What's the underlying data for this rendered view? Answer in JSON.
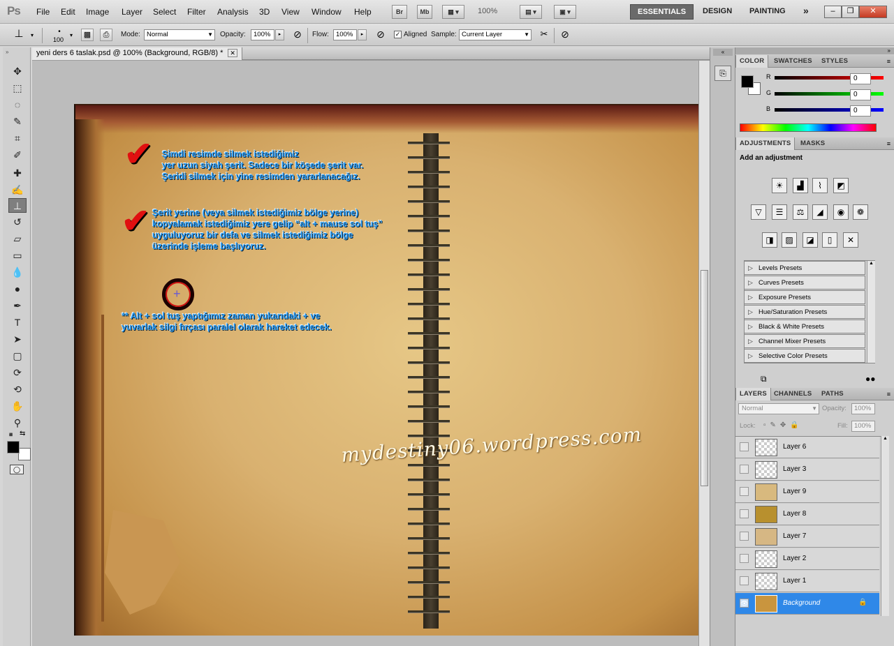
{
  "app": {
    "logo": "Ps",
    "menus": [
      "File",
      "Edit",
      "Image",
      "Layer",
      "Select",
      "Filter",
      "Analysis",
      "3D",
      "View",
      "Window",
      "Help"
    ],
    "app_bar": {
      "bridge": "Br",
      "minibridge": "Mb",
      "zoom": "100%"
    },
    "workspaces": [
      "ESSENTIALS",
      "DESIGN",
      "PAINTING"
    ],
    "workspace_more": "»",
    "window_buttons": [
      "–",
      "❐",
      "✕"
    ]
  },
  "options": {
    "brush_size": "100",
    "mode_label": "Mode:",
    "mode_value": "Normal",
    "opacity_label": "Opacity:",
    "opacity_value": "100%",
    "flow_label": "Flow:",
    "flow_value": "100%",
    "aligned_label": "Aligned",
    "aligned_checked": true,
    "sample_label": "Sample:",
    "sample_value": "Current Layer"
  },
  "document": {
    "tab_title": "yeni ders 6 taslak.psd @ 100% (Background, RGB/8) *",
    "close": "✕",
    "annotation1": "Şimdi resimde silmek istediğimiz\nyer uzun siyah şerit. Sadece bir köşede şerit var.\nŞeridi silmek için yine resimden yararlanacağız.",
    "annotation2": "Şerit yerine (veya silmek istediğimiz bölge yerine)\nkopyalamak istediğimiz yere gelip “alt + mause sol tuş”\nuyguluyoruz bir defa ve silmek istediğimiz bölge\nüzerinde işleme başlıyoruz.",
    "annotation3": "** Alt + sol tuş yaptığımız zaman yukarıdaki + ve\nyuvarlak silgi fırçası paralel olarak hareket edecek.",
    "watermark": "mydestiny06.wordpress.com"
  },
  "color_panel": {
    "tabs": [
      "COLOR",
      "SWATCHES",
      "STYLES"
    ],
    "r_label": "R",
    "r_value": "0",
    "g_label": "G",
    "g_value": "0",
    "b_label": "B",
    "b_value": "0"
  },
  "adjustments_panel": {
    "tabs": [
      "ADJUSTMENTS",
      "MASKS"
    ],
    "heading": "Add an adjustment",
    "presets": [
      "Levels Presets",
      "Curves Presets",
      "Exposure Presets",
      "Hue/Saturation Presets",
      "Black & White Presets",
      "Channel Mixer Presets",
      "Selective Color Presets"
    ]
  },
  "layers_panel": {
    "tabs": [
      "LAYERS",
      "CHANNELS",
      "PATHS"
    ],
    "blend_mode": "Normal",
    "opacity_label": "Opacity:",
    "opacity_value": "100%",
    "lock_label": "Lock:",
    "fill_label": "Fill:",
    "fill_value": "100%",
    "layers": [
      "Layer 6",
      "Layer 3",
      "Layer 9",
      "Layer 8",
      "Layer 7",
      "Layer 2",
      "Layer 1",
      "Background"
    ],
    "selected_layer": "Background"
  }
}
